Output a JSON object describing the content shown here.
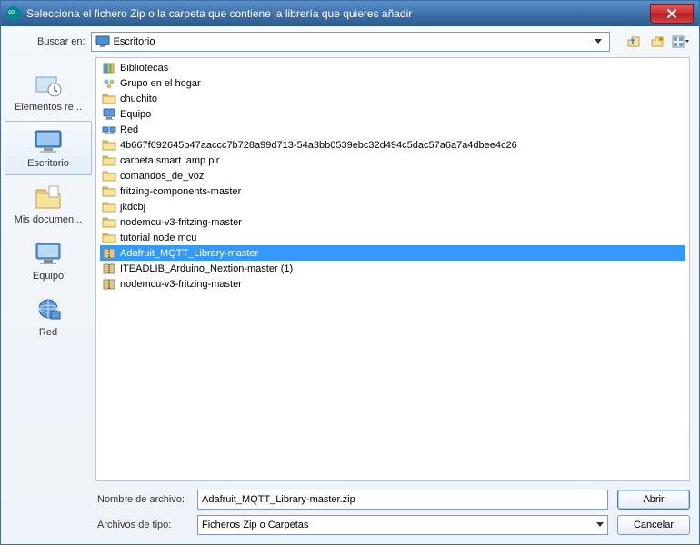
{
  "title": "Selecciona el fichero Zip o la carpeta que contiene la librería que quieres añadir",
  "toolbar": {
    "look_in_label": "Buscar en:",
    "look_in_value": "Escritorio"
  },
  "places": [
    {
      "id": "recent",
      "label": "Elementos re...",
      "icon": "recent"
    },
    {
      "id": "desktop",
      "label": "Escritorio",
      "icon": "desktop",
      "selected": true
    },
    {
      "id": "documents",
      "label": "Mis documen...",
      "icon": "documents"
    },
    {
      "id": "computer",
      "label": "Equipo",
      "icon": "computer"
    },
    {
      "id": "network",
      "label": "Red",
      "icon": "network"
    }
  ],
  "files": [
    {
      "name": "Bibliotecas",
      "type": "libraries"
    },
    {
      "name": "Grupo en el hogar",
      "type": "homegroup"
    },
    {
      "name": "chuchito",
      "type": "folder"
    },
    {
      "name": "Equipo",
      "type": "computer"
    },
    {
      "name": "Red",
      "type": "network"
    },
    {
      "name": "4b667f692645b47aaccc7b728a99d713-54a3bb0539ebc32d494c5dac57a6a7a4dbee4c26",
      "type": "folder"
    },
    {
      "name": "carpeta smart lamp pir",
      "type": "folder"
    },
    {
      "name": "comandos_de_voz",
      "type": "folder"
    },
    {
      "name": "fritzing-components-master",
      "type": "folder"
    },
    {
      "name": "jkdcbj",
      "type": "folder"
    },
    {
      "name": "nodemcu-v3-fritzing-master",
      "type": "folder"
    },
    {
      "name": "tutorial node mcu",
      "type": "folder"
    },
    {
      "name": "Adafruit_MQTT_Library-master",
      "type": "zip",
      "selected": true
    },
    {
      "name": "ITEADLIB_Arduino_Nextion-master (1)",
      "type": "zip"
    },
    {
      "name": "nodemcu-v3-fritzing-master",
      "type": "zip"
    }
  ],
  "bottom": {
    "filename_label": "Nombre de archivo:",
    "filename_value": "Adafruit_MQTT_Library-master.zip",
    "filetype_label": "Archivos de tipo:",
    "filetype_value": "Ficheros Zip o Carpetas",
    "open_label": "Abrir",
    "cancel_label": "Cancelar"
  }
}
